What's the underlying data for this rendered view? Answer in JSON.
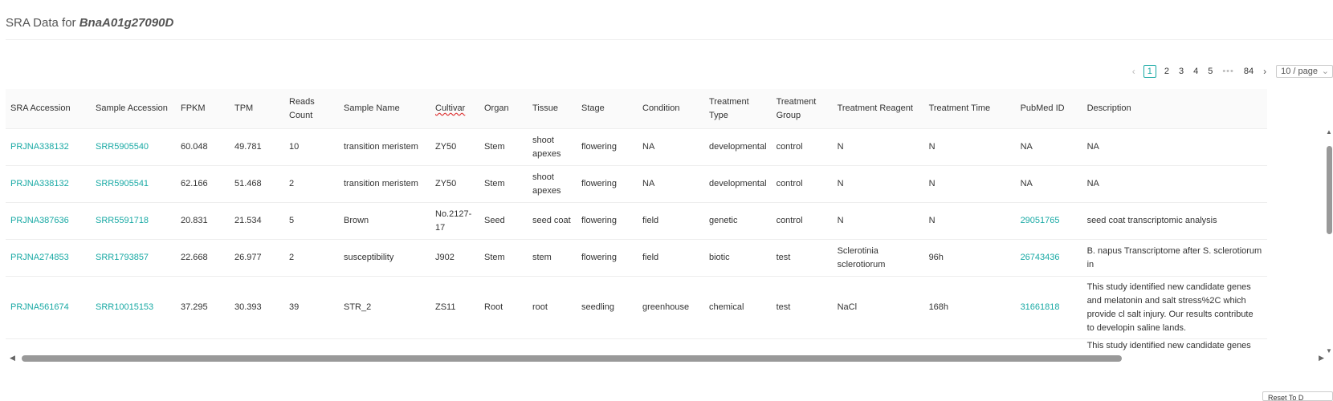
{
  "header": {
    "title_prefix": "SRA Data for",
    "gene_id": "BnaA01g27090D"
  },
  "pagination": {
    "prev_icon": "‹",
    "pages": [
      "1",
      "2",
      "3",
      "4",
      "5"
    ],
    "ellipsis": "•••",
    "last_page": "84",
    "next_icon": "›",
    "page_size": "10 / page",
    "active_page": "1"
  },
  "table": {
    "columns": [
      "SRA Accession",
      "Sample Accession",
      "FPKM",
      "TPM",
      "Reads Count",
      "Sample Name",
      "Cultivar",
      "Organ",
      "Tissue",
      "Stage",
      "Condition",
      "Treatment Type",
      "Treatment Group",
      "Treatment Reagent",
      "Treatment Time",
      "PubMed ID",
      "Description"
    ],
    "rows": [
      [
        "PRJNA338132",
        "SRR5905540",
        "60.048",
        "49.781",
        "10",
        "transition meristem",
        "ZY50",
        "Stem",
        "shoot apexes",
        "flowering",
        "NA",
        "developmental",
        "control",
        "N",
        "N",
        "NA",
        "NA"
      ],
      [
        "PRJNA338132",
        "SRR5905541",
        "62.166",
        "51.468",
        "2",
        "transition meristem",
        "ZY50",
        "Stem",
        "shoot apexes",
        "flowering",
        "NA",
        "developmental",
        "control",
        "N",
        "N",
        "NA",
        "NA"
      ],
      [
        "PRJNA387636",
        "SRR5591718",
        "20.831",
        "21.534",
        "5",
        "Brown",
        "No.2127-17",
        "Seed",
        "seed coat",
        "flowering",
        "field",
        "genetic",
        "control",
        "N",
        "N",
        "29051765",
        "seed coat transcriptomic analysis"
      ],
      [
        "PRJNA274853",
        "SRR1793857",
        "22.668",
        "26.977",
        "2",
        "susceptibility",
        "J902",
        "Stem",
        "stem",
        "flowering",
        "field",
        "biotic",
        "test",
        "Sclerotinia sclerotiorum",
        "96h",
        "26743436",
        "B. napus Transcriptome after S. sclerotiorum in"
      ],
      [
        "PRJNA561674",
        "SRR10015153",
        "37.295",
        "30.393",
        "39",
        "STR_2",
        "ZS11",
        "Root",
        "root",
        "seedling",
        "greenhouse",
        "chemical",
        "test",
        "NaCl",
        "168h",
        "31661818",
        "This study identified new candidate genes and melatonin and salt stress%2C which provide cl salt injury. Our results contribute to developin saline lands."
      ],
      [
        "",
        "",
        "",
        "",
        "",
        "",
        "",
        "",
        "",
        "",
        "",
        "",
        "",
        "",
        "",
        "",
        "This study identified new candidate genes and"
      ]
    ]
  },
  "corner_button": "Reset To D"
}
